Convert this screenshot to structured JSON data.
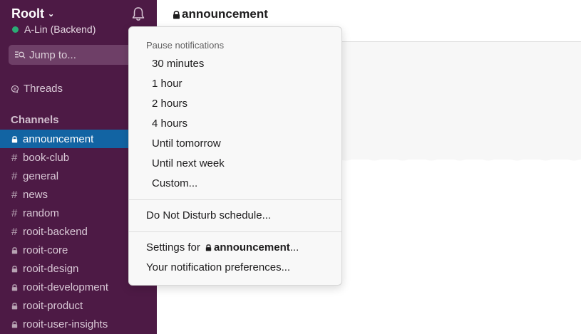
{
  "workspace": {
    "name": "Roolt",
    "user_name": "A-Lin (Backend)",
    "presence_color": "#2bac76"
  },
  "sidebar": {
    "jump_label": "Jump to...",
    "threads_label": "Threads",
    "channels_header": "Channels",
    "channels": [
      {
        "name": "announcement",
        "private": true,
        "active": true
      },
      {
        "name": "book-club",
        "private": false,
        "active": false
      },
      {
        "name": "general",
        "private": false,
        "active": false
      },
      {
        "name": "news",
        "private": false,
        "active": false
      },
      {
        "name": "random",
        "private": false,
        "active": false
      },
      {
        "name": "rooit-backend",
        "private": false,
        "active": false
      },
      {
        "name": "rooit-core",
        "private": true,
        "active": false
      },
      {
        "name": "rooit-design",
        "private": true,
        "active": false
      },
      {
        "name": "rooit-development",
        "private": true,
        "active": false
      },
      {
        "name": "rooit-product",
        "private": true,
        "active": false
      },
      {
        "name": "rooit-user-insights",
        "private": true,
        "active": false
      }
    ]
  },
  "main": {
    "channel_title": "announcement"
  },
  "menu": {
    "pause_label": "Pause notifications",
    "pause_options": [
      "30 minutes",
      "1 hour",
      "2 hours",
      "4 hours",
      "Until tomorrow",
      "Until next week",
      "Custom..."
    ],
    "dnd_schedule": "Do Not Disturb schedule...",
    "settings_prefix": "Settings for ",
    "settings_channel": "announcement",
    "settings_suffix": "...",
    "notification_prefs": "Your notification preferences..."
  },
  "colors": {
    "sidebar_bg": "#4d1a45",
    "active_channel": "#1264a3"
  },
  "icons": [
    "bell-icon",
    "search-icon",
    "threads-icon",
    "lock-icon",
    "hash-icon",
    "chevron-down-icon"
  ]
}
